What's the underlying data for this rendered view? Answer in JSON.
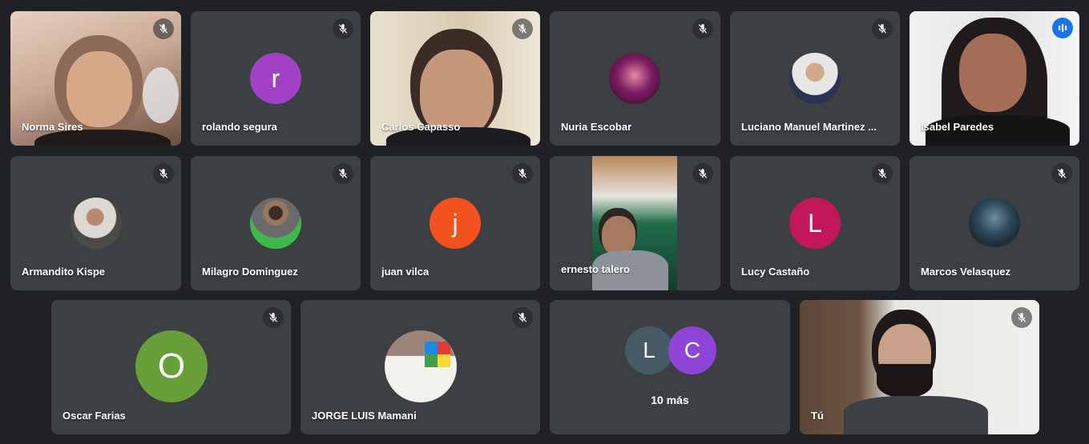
{
  "participants": [
    {
      "name": "Norma Sires",
      "kind": "video",
      "muted": true
    },
    {
      "name": "rolando segura",
      "kind": "initial",
      "initial": "r",
      "color": "#a142c6",
      "muted": true
    },
    {
      "name": "Carlos Capasso",
      "kind": "video",
      "muted": true
    },
    {
      "name": "Nuria Escobar",
      "kind": "photo",
      "muted": true
    },
    {
      "name": "Luciano Manuel Martinez ...",
      "kind": "photo",
      "muted": true
    },
    {
      "name": "Isabel Paredes",
      "kind": "video",
      "muted": false,
      "speaking": true
    },
    {
      "name": "Armandito Kispe",
      "kind": "photo",
      "muted": true
    },
    {
      "name": "Milagro Dominguez",
      "kind": "photo",
      "muted": true
    },
    {
      "name": "juan vilca",
      "kind": "initial",
      "initial": "j",
      "color": "#f4511e",
      "muted": true
    },
    {
      "name": "ernesto talero",
      "kind": "video",
      "muted": true
    },
    {
      "name": "Lucy Castaño",
      "kind": "initial",
      "initial": "L",
      "color": "#c2185b",
      "muted": true
    },
    {
      "name": "Marcos Velasquez",
      "kind": "photo",
      "muted": true
    },
    {
      "name": "Oscar Farias",
      "kind": "initial",
      "initial": "O",
      "color": "#689f38",
      "muted": true
    },
    {
      "name": "JORGE LUIS Mamani",
      "kind": "photo",
      "muted": true
    },
    {
      "name": "Tú",
      "kind": "video",
      "muted": true
    }
  ],
  "more": {
    "label": "10 más",
    "avatars": [
      {
        "initial": "L",
        "color": "#455a64"
      },
      {
        "initial": "C",
        "color": "#8e44d6"
      }
    ]
  },
  "icons": {
    "mute": "mic-off-icon",
    "speaking": "audio-level-icon"
  }
}
